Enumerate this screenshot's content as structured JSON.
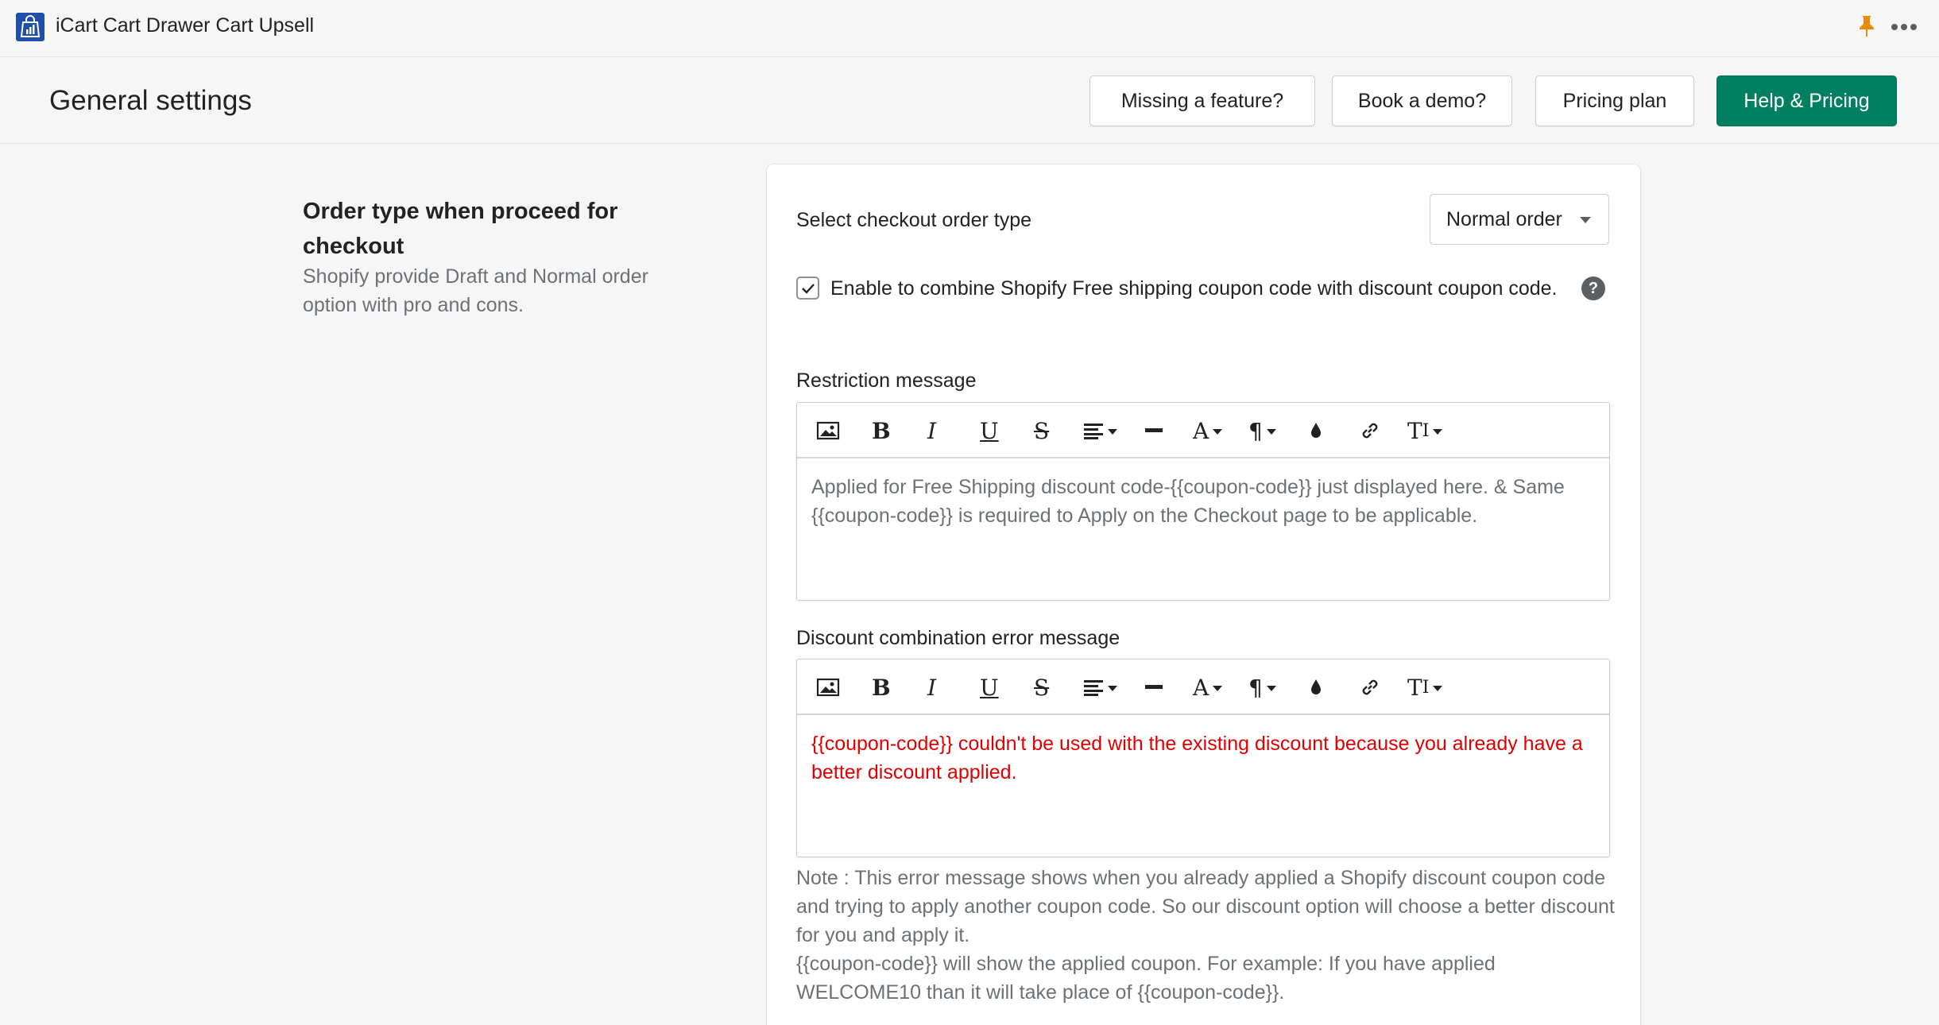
{
  "app": {
    "title": "iCart Cart Drawer Cart Upsell",
    "logo_icon": "shopping-bag-chart-icon",
    "pin_icon": "pin-icon",
    "more_icon": "more-horizontal-icon"
  },
  "header": {
    "title": "General settings",
    "buttons": {
      "missing_feature": "Missing a feature?",
      "book_demo": "Book a demo?",
      "pricing_plan": "Pricing plan",
      "help_pricing": "Help & Pricing"
    }
  },
  "section": {
    "title": "Order type when proceed for checkout",
    "description": "Shopify provide Draft and Normal order option with pro and cons."
  },
  "card": {
    "order_type_label": "Select checkout order type",
    "order_type_value": "Normal order",
    "combine_checkbox": {
      "checked": true,
      "label": "Enable to combine Shopify Free shipping coupon code with discount coupon code."
    },
    "restriction": {
      "label": "Restriction message",
      "content": "Applied for Free Shipping discount code-{{coupon-code}} just displayed here. & Same {{coupon-code}} is required to Apply on the Checkout page to be applicable."
    },
    "discount_error": {
      "label": "Discount combination error message",
      "content": "{{coupon-code}} couldn't be used with the existing discount because you already have a better discount applied."
    },
    "note": {
      "line1": "Note : This error message shows when you already applied a Shopify discount coupon code and trying to apply another coupon code. So our discount option will choose a better discount for you and apply it.",
      "line2": "{{coupon-code}} will show the applied coupon. For example: If you have applied WELCOME10 than it will take place of {{coupon-code}}."
    }
  },
  "toolbar_icons": [
    "image-icon",
    "bold-icon",
    "italic-icon",
    "underline-icon",
    "strikethrough-icon",
    "align-icon",
    "horizontal-rule-icon",
    "font-size-icon",
    "paragraph-icon",
    "text-color-icon",
    "link-icon",
    "clear-format-icon"
  ],
  "colors": {
    "primary": "#008060",
    "error_text": "#e00000",
    "muted_text": "#6d7175",
    "logo": "#1f4fa8",
    "pin": "#e88a0c"
  }
}
